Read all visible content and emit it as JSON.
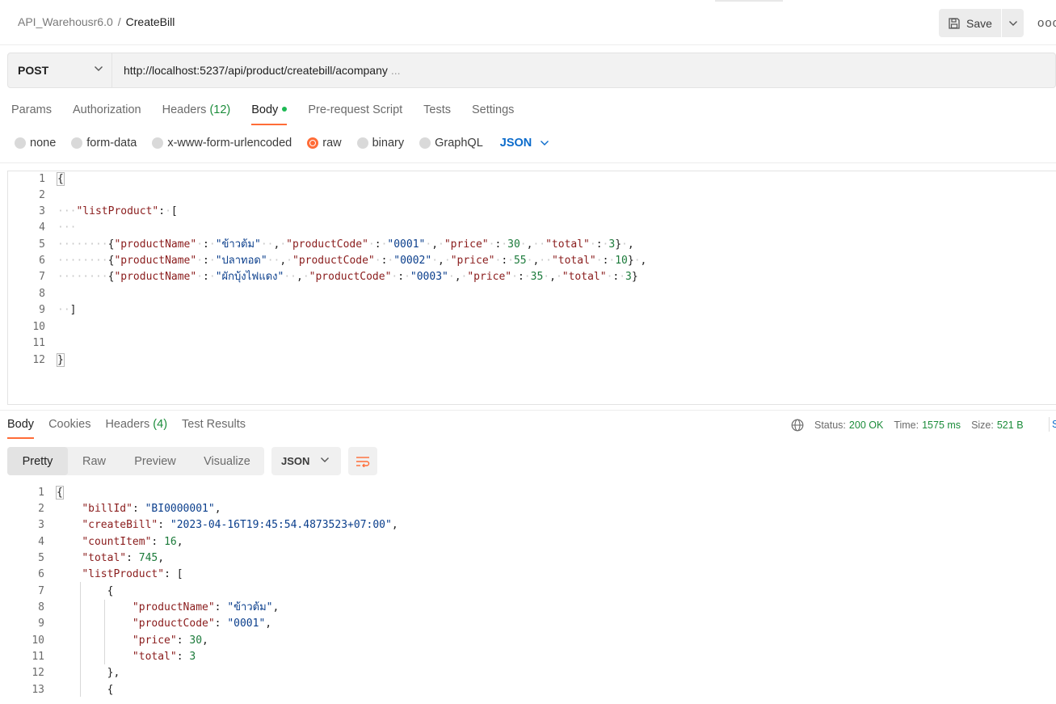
{
  "header": {
    "collection": "API_Warehousr6.0",
    "separator": "/",
    "request_name": "CreateBill",
    "save_label": "Save",
    "more_icon": "ooo"
  },
  "request": {
    "method": "POST",
    "url": "http://localhost:5237/api/product/createbill/acompany",
    "url_ellipsis": "..."
  },
  "request_tabs": [
    {
      "label": "Params"
    },
    {
      "label": "Authorization"
    },
    {
      "label": "Headers",
      "count": "(12)"
    },
    {
      "label": "Body"
    },
    {
      "label": "Pre-request Script"
    },
    {
      "label": "Tests"
    },
    {
      "label": "Settings"
    }
  ],
  "body_types": [
    {
      "label": "none"
    },
    {
      "label": "form-data"
    },
    {
      "label": "x-www-form-urlencoded"
    },
    {
      "label": "raw",
      "selected": true
    },
    {
      "label": "binary"
    },
    {
      "label": "GraphQL"
    }
  ],
  "body_language": "JSON",
  "request_body": {
    "line_numbers": [
      "1",
      "2",
      "3",
      "4",
      "5",
      "6",
      "7",
      "8",
      "9",
      "10",
      "11",
      "12"
    ],
    "products": [
      {
        "productName": "ข้าวต้ม",
        "productCode": "0001",
        "price": "30",
        "total": "3"
      },
      {
        "productName": "ปลาทอด",
        "productCode": "0002",
        "price": "55",
        "total": "10"
      },
      {
        "productName": "ผักบุ้งไฟแดง",
        "productCode": "0003",
        "price": "35",
        "total": "3"
      }
    ]
  },
  "response_tabs": [
    {
      "label": "Body"
    },
    {
      "label": "Cookies"
    },
    {
      "label": "Headers",
      "count": "(4)"
    },
    {
      "label": "Test Results"
    }
  ],
  "response_status": {
    "status_label": "Status:",
    "status_value": "200 OK",
    "time_label": "Time:",
    "time_value": "1575 ms",
    "size_label": "Size:",
    "size_value": "521 B",
    "truncated_letter": "S"
  },
  "response_views": [
    "Pretty",
    "Raw",
    "Preview",
    "Visualize"
  ],
  "response_format": "JSON",
  "response_body": {
    "line_numbers": [
      "1",
      "2",
      "3",
      "4",
      "5",
      "6",
      "7",
      "8",
      "9",
      "10",
      "11",
      "12",
      "13"
    ],
    "billId": "\"BI0000001\"",
    "createBill": "\"2023-04-16T19:45:54.4873523+07:00\"",
    "countItem": "16",
    "total": "745",
    "item": {
      "productName": "\"ข้าวต้ม\"",
      "productCode": "\"0001\"",
      "price": "30",
      "total": "3"
    }
  },
  "colors": {
    "accent": "#ff6c37",
    "status_ok": "#1b8c3a",
    "link_blue": "#0b6bcb",
    "json_key": "#8a1c1c",
    "json_string": "#0a3e8c",
    "json_number": "#1b7a3a"
  }
}
